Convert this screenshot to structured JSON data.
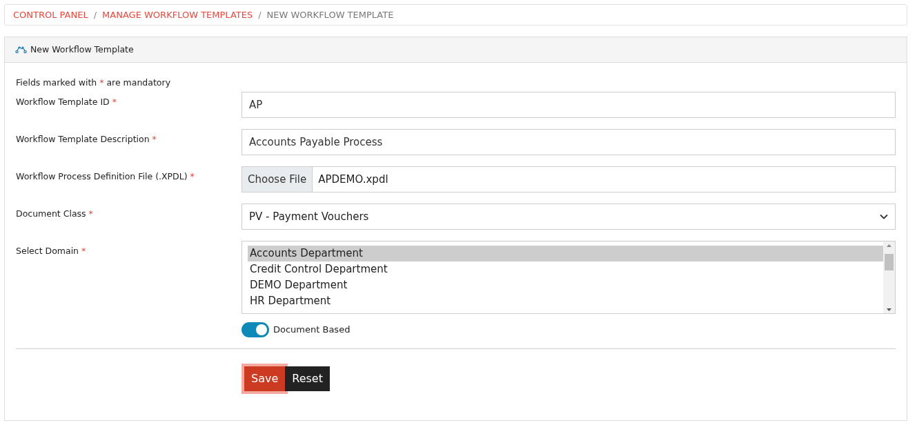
{
  "breadcrumb": [
    {
      "label": "CONTROL PANEL",
      "link": true
    },
    {
      "label": "MANAGE WORKFLOW TEMPLATES",
      "link": true
    },
    {
      "label": "NEW WORKFLOW TEMPLATE",
      "link": false
    }
  ],
  "breadcrumb_separator": "/",
  "card": {
    "title": "New Workflow Template"
  },
  "note": {
    "before": "Fields marked with",
    "mark": "*",
    "after": "are mandatory"
  },
  "fields": [
    {
      "kind": "text",
      "label": "Workflow Template ID",
      "required_mark": "*",
      "value": "AP"
    },
    {
      "kind": "text",
      "label": "Workflow Template Description",
      "required_mark": "*",
      "value": "Accounts Payable Process"
    },
    {
      "kind": "file",
      "label": "Workflow Process Definition File (.XPDL)",
      "required_mark": "*",
      "button": "Choose File",
      "value": "APDEMO.xpdl"
    },
    {
      "kind": "select",
      "label": "Document Class",
      "required_mark": "*",
      "value": "PV - Payment Vouchers"
    },
    {
      "kind": "listbox",
      "label": "Select Domain",
      "required_mark": "*",
      "options": [
        {
          "label": "Accounts Department",
          "selected": true
        },
        {
          "label": "Credit Control Department",
          "selected": false
        },
        {
          "label": "DEMO Department",
          "selected": false
        },
        {
          "label": "HR Department",
          "selected": false
        }
      ]
    }
  ],
  "toggle": {
    "label": "Document Based",
    "on": true
  },
  "buttons": [
    {
      "label": "Save",
      "kind": "primary"
    },
    {
      "label": "Reset",
      "kind": "secondary"
    }
  ]
}
